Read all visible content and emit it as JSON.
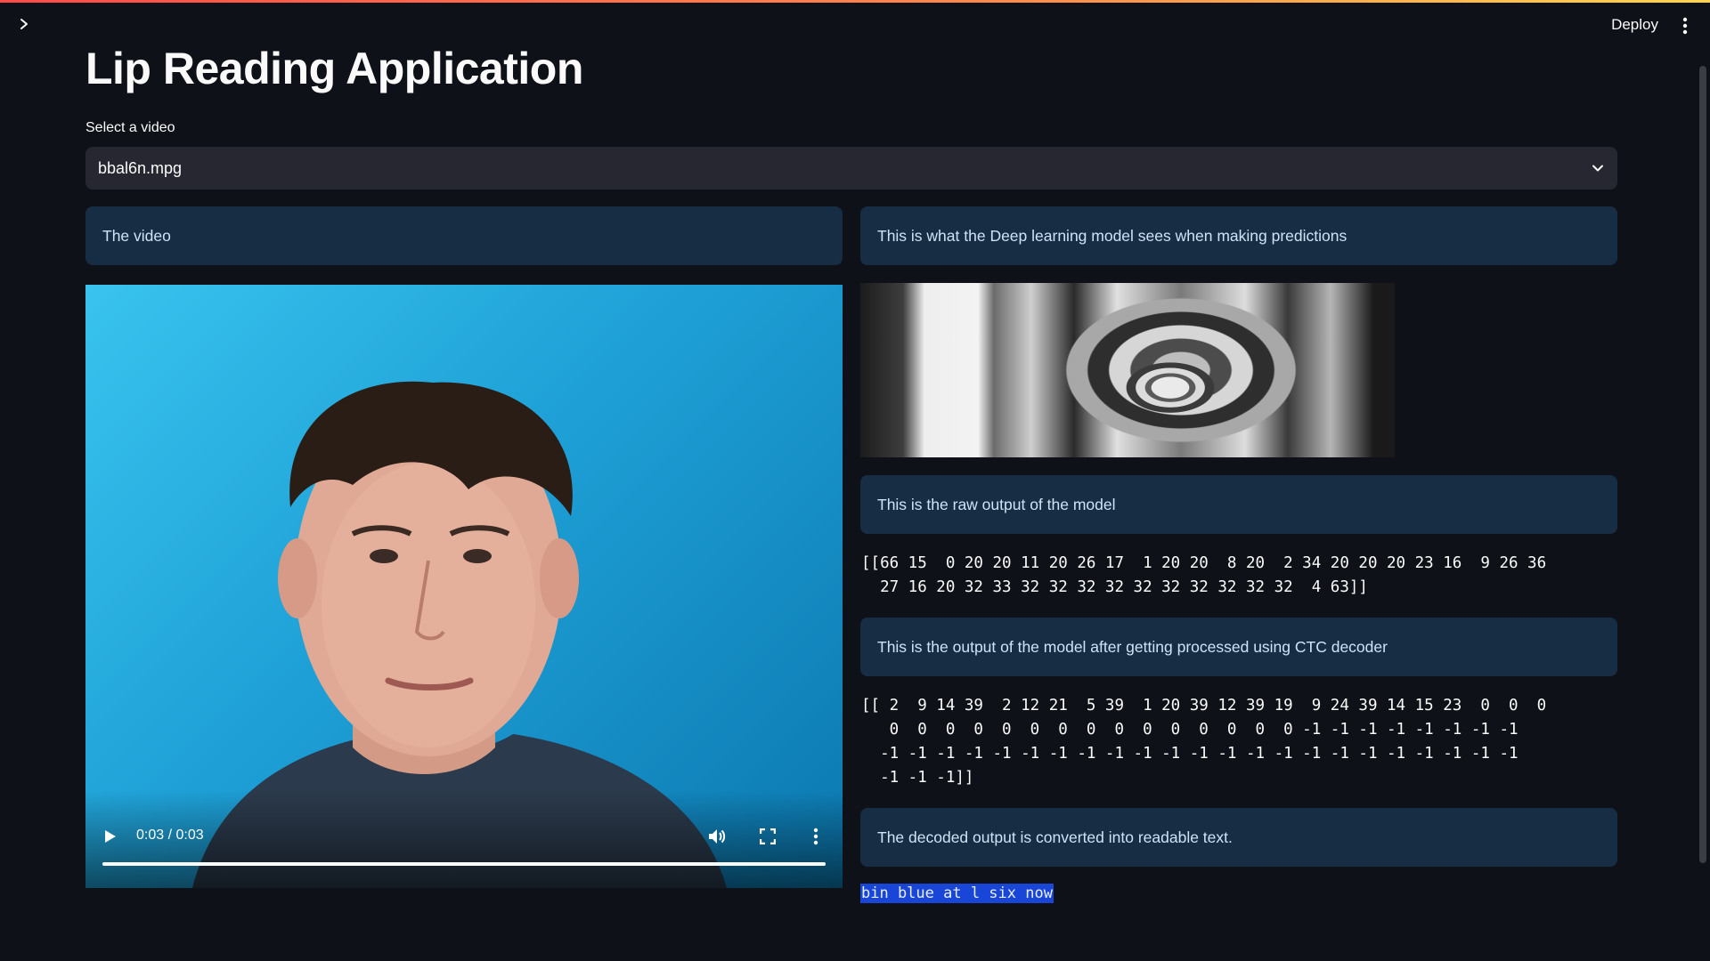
{
  "header": {
    "deploy_label": "Deploy",
    "icons": {
      "sidebar_toggle": "chevron-right-icon",
      "menu": "kebab-menu-icon"
    },
    "accent_gradient": [
      "#ff4b4b",
      "#ff8c4b",
      "#ffd54b"
    ]
  },
  "main": {
    "title": "Lip Reading Application",
    "select": {
      "label": "Select a video",
      "value": "bbal6n.mpg"
    },
    "left_column": {
      "info": "The video",
      "video_player": {
        "time": "0:03 / 0:03",
        "progress": 1.0
      }
    },
    "right_column": {
      "frames_info": "This is what the Deep learning model sees when making predictions",
      "raw_info": "This is the raw output of the model",
      "raw_output": "[[66 15  0 20 20 11 20 26 17  1 20 20  8 20  2 34 20 20 20 23 16  9 26 36\n  27 16 20 32 33 32 32 32 32 32 32 32 32 32 32  4 63]]",
      "ctc_info": "This is the output of the model after getting processed using CTC decoder",
      "ctc_output": "[[ 2  9 14 39  2 12 21  5 39  1 20 39 12 39 19  9 24 39 14 15 23  0  0  0\n   0  0  0  0  0  0  0  0  0  0  0  0  0  0  0 -1 -1 -1 -1 -1 -1 -1 -1\n  -1 -1 -1 -1 -1 -1 -1 -1 -1 -1 -1 -1 -1 -1 -1 -1 -1 -1 -1 -1 -1 -1 -1\n  -1 -1 -1]]",
      "decoded_info": "The decoded output is converted into readable text.",
      "decoded_text": "bin blue at l six now"
    }
  },
  "colors": {
    "background": "#0e1117",
    "info_box": "#172d43",
    "select_bg": "#262730",
    "highlight": "#1a46d8"
  }
}
